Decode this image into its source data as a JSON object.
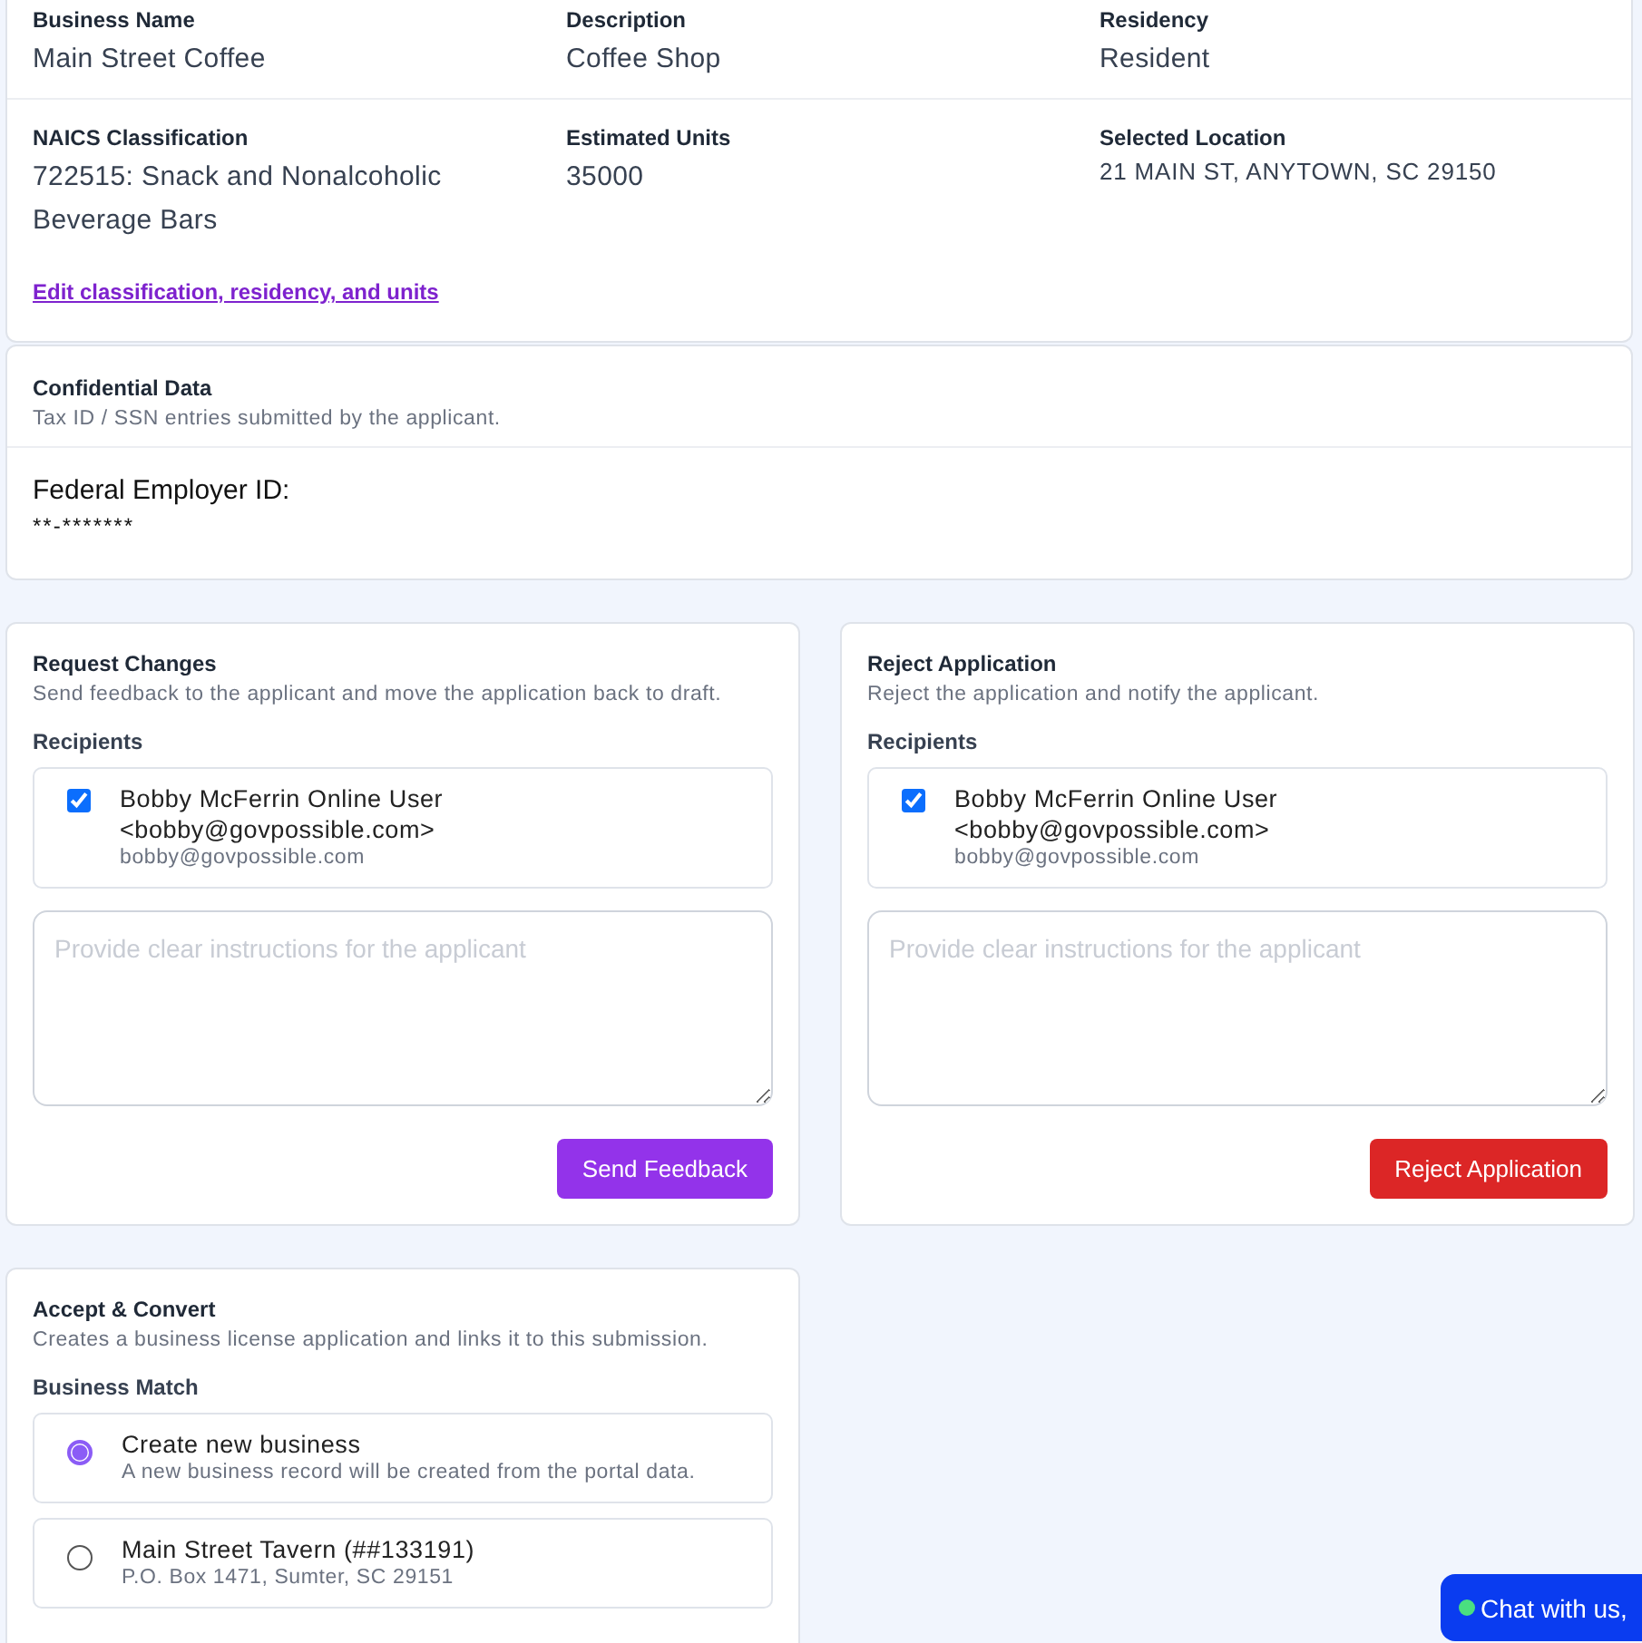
{
  "summary": {
    "fields": [
      {
        "label": "Business Name",
        "value": "Main Street Coffee",
        "kind": "large"
      },
      {
        "label": "Description",
        "value": "Coffee Shop",
        "kind": "large"
      },
      {
        "label": "Residency",
        "value": "Resident",
        "kind": "large"
      },
      {
        "label": "NAICS Classification",
        "value": "722515: Snack and Nonalcoholic Beverage Bars",
        "kind": "large"
      },
      {
        "label": "Estimated Units",
        "value": "35000",
        "kind": "large"
      },
      {
        "label": "Selected Location",
        "value": "21 MAIN ST, ANYTOWN, SC 29150",
        "kind": "small"
      }
    ],
    "edit_link": "Edit classification, residency, and units"
  },
  "confidential": {
    "title": "Confidential Data",
    "subtitle": "Tax ID / SSN entries submitted by the applicant.",
    "label": "Federal Employer ID:",
    "value": "**-*******"
  },
  "actions": [
    {
      "kind": "feedback",
      "title": "Request Changes",
      "subtitle": "Send feedback to the applicant and move the application back to draft.",
      "recipients_label": "Recipients",
      "recipients": [
        {
          "name": "Bobby McFerrin Online User <bobby@govpossible.com>",
          "email": "bobby@govpossible.com",
          "checked": true
        }
      ],
      "placeholder": "Provide clear instructions for the applicant",
      "button": "Send Feedback"
    },
    {
      "kind": "reject",
      "title": "Reject Application",
      "subtitle": "Reject the application and notify the applicant.",
      "recipients_label": "Recipients",
      "recipients": [
        {
          "name": "Bobby McFerrin Online User <bobby@govpossible.com>",
          "email": "bobby@govpossible.com",
          "checked": true
        }
      ],
      "placeholder": "Provide clear instructions for the applicant",
      "button": "Reject Application"
    }
  ],
  "accept": {
    "title": "Accept & Convert",
    "subtitle": "Creates a business license application and links it to this submission.",
    "match_label": "Business Match",
    "options": [
      {
        "title": "Create new business",
        "detail": "A new business record will be created from the portal data.",
        "selected": true
      },
      {
        "title": "Main Street Tavern (##133191)",
        "detail": "P.O. Box 1471, Sumter, SC 29151",
        "selected": false
      }
    ]
  },
  "chat_button": "Chat with us,"
}
